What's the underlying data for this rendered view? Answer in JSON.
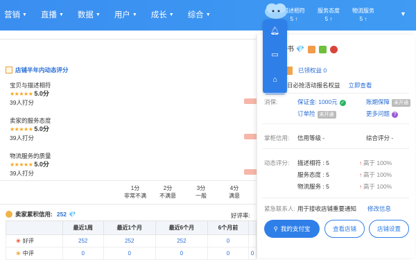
{
  "nav": {
    "items": [
      "营销",
      "直播",
      "数据",
      "用户",
      "成长",
      "综合"
    ]
  },
  "top_scores": [
    {
      "label": "描述相符",
      "value": "5"
    },
    {
      "label": "服务态度",
      "value": "5"
    },
    {
      "label": "物流服务",
      "value": "5"
    }
  ],
  "dynamic": {
    "title": "店铺半年内动态评分",
    "items": [
      {
        "label": "宝贝与描述相符",
        "stars": "★★★★★",
        "score": "5.0分",
        "count": "39人打分"
      },
      {
        "label": "卖家的服务态度",
        "stars": "★★★★★",
        "score": "5.0分",
        "count": "39人打分"
      },
      {
        "label": "物流服务的质量",
        "stars": "★★★★★",
        "score": "5.0分",
        "count": "39人打分"
      }
    ],
    "scale": [
      {
        "value": "1分",
        "desc": "非常不满"
      },
      {
        "value": "2分",
        "desc": "不满意"
      },
      {
        "value": "3分",
        "desc": "一般"
      },
      {
        "value": "4分",
        "desc": "满意"
      }
    ]
  },
  "credit": {
    "label": "卖家累积信用:",
    "value": "252",
    "rate_label": "好评率:"
  },
  "table": {
    "headers": [
      "",
      "最近1周",
      "最近1个月",
      "最近6个月",
      "6个月前",
      ""
    ],
    "rows": [
      {
        "label": "好评",
        "cells": [
          "252",
          "252",
          "252",
          "0",
          ""
        ]
      },
      {
        "label": "中评",
        "cells": [
          "0",
          "0",
          "0",
          "0",
          "0"
        ]
      }
    ]
  },
  "shop": {
    "name_suffix": "书",
    "rights": "已领权益 0",
    "activity": "日必抢活动报名权益",
    "view_now": "立即查看"
  },
  "guarantee": {
    "label": "消保:",
    "deposit": "保证金: 1000元",
    "account_guarantee": "账期保障",
    "order_insurance": "订单险",
    "more_issues": "更多问题",
    "tag_closed": "未开通"
  },
  "shop_credit": {
    "label": "掌柜信用:",
    "level": "信用等级 -",
    "overall": "综合评分 -"
  },
  "dynamic_scores": {
    "label": "动态评分:",
    "rows": [
      {
        "name": "描述相符 : 5",
        "cmp": "高于 100%"
      },
      {
        "name": "服务态度 : 5",
        "cmp": "高于 100%"
      },
      {
        "name": "物流服务 : 5",
        "cmp": "高于 100%"
      }
    ]
  },
  "contact": {
    "label": "紧急联系人:",
    "desc": "用于接收店铺重要通知",
    "link": "修改信息"
  },
  "buttons": {
    "alipay": "我的支付宝",
    "view_shop": "查看店铺",
    "settings": "店铺设置"
  }
}
